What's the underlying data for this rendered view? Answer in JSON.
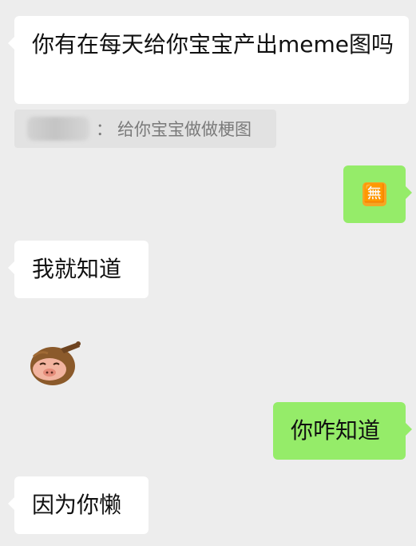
{
  "messages": [
    {
      "side": "left",
      "text": "你有在每天给你宝宝产出meme图吗"
    },
    {
      "side": "quote",
      "sender": "",
      "separator": "：",
      "text": "给你宝宝做做梗图"
    },
    {
      "side": "right",
      "emoji": "🈚"
    },
    {
      "side": "left",
      "text": "我就知道"
    },
    {
      "side": "left",
      "sticker": "pig-sticker"
    },
    {
      "side": "right",
      "text": "你咋知道"
    },
    {
      "side": "left",
      "text": "因为你懒"
    }
  ],
  "colors": {
    "background": "#ededed",
    "incoming_bubble": "#ffffff",
    "outgoing_bubble": "#95ec69",
    "quote_box": "#e2e2e2",
    "quote_text": "#7a7a7a",
    "emoji_orange": "#f5a623"
  }
}
